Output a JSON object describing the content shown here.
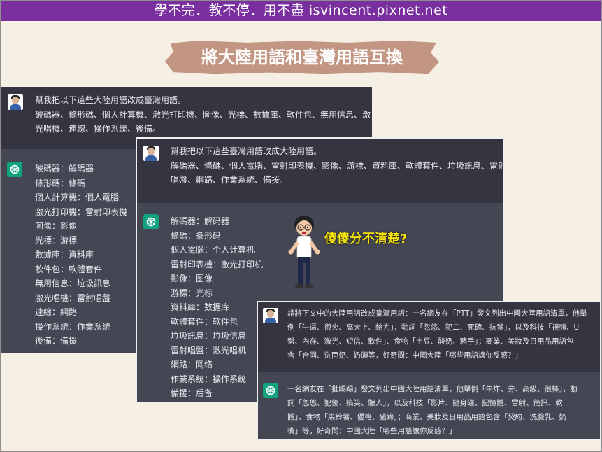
{
  "banner": {
    "text": "學不完．教不停．用不盡 isvincent.pixnet.net"
  },
  "title": {
    "text": "將大陸用語和臺灣用語互換"
  },
  "panel1": {
    "prompt_lines": [
      "幫我把以下這些大陸用語改成臺灣用語。",
      "破碼器、條形碼、個人計算機、激光打印機、圖像、光標、數據庫、軟件包、無用信息、激",
      "光唱機、連線、操作系統、後備。"
    ],
    "answer_lines": [
      "破碼器：解碼器",
      "條形碼：條碼",
      "個人計算機：個人電腦",
      "激光打印機：雷射印表機",
      "圖像：影像",
      "光標：游標",
      "數據庫：資料庫",
      "軟件包：軟體套件",
      "無用信息：垃圾訊息",
      "激光唱機：雷射唱盤",
      "連線：網路",
      "操作系統：作業系統",
      "後備：備援"
    ]
  },
  "panel2": {
    "prompt_lines": [
      "幫我把以下這些臺灣用語改成大陸用語。",
      "解碼器、條碼、個人電腦、雷射印表機、影像、游標、資料庫、軟體套件、垃圾訊息、雷射",
      "唱盤、網路、作業系統、備援。"
    ],
    "answer_lines": [
      "解碼器：解码器",
      "條碼：条形码",
      "個人電腦：个人计算机",
      "雷射印表機：激光打印机",
      "影像：图像",
      "游標：光标",
      "資料庫：数据库",
      "軟體套件：软件包",
      "垃圾訊息：垃圾信息",
      "雷射唱盤：激光唱机",
      "網路：网络",
      "作業系統：操作系统",
      "備援：后备"
    ]
  },
  "panel3": {
    "prompt_lines": [
      "請將下文中的大陸用語改成臺灣用語：一名網友在「PTT」發文列出中國大陸用語清單，他舉",
      "例「牛逼、很火、高大上、給力」，動詞「忽悠、犯二、死磕、抗爹」，以及科技「視頻、U",
      "盤、內存、激光、短信、軟件」、食物「土豆、酸奶、豬手」；商業、美妝及日用品用語包",
      "含「合同、洗面奶、奶頭等，好奇問：中國大陸「哪些用語讓你反感？」"
    ],
    "answer_lines": [
      "一名網友在「批踢踢」發文列出中國大陸用語清單，他舉例「牛炸、夯、高級、很棒」，動",
      "詞「忽悠、犯傻、搞笑、騙人」，以及科技「影片、隨身碟、記憶體、雷射、簡訊、軟",
      "體」、食物「馬鈴薯、優格、豬蹄」；商業、美妝及日用品用語包含「契約、洗臉乳、奶",
      "嘴」等，好奇問：中國大陸「哪些用語讓你反感？」"
    ]
  },
  "callout": {
    "text": "傻傻分不清楚?"
  },
  "icons": {
    "user": "user-avatar-icon",
    "assistant": "chatgpt-logo-icon",
    "cartoon": "cartoon-character"
  },
  "colors": {
    "banner": "#7a2f9e",
    "prompt_bg": "#343541",
    "answer_bg": "#444654",
    "gpt_green": "#10a37f",
    "callout": "#f5e20f"
  }
}
